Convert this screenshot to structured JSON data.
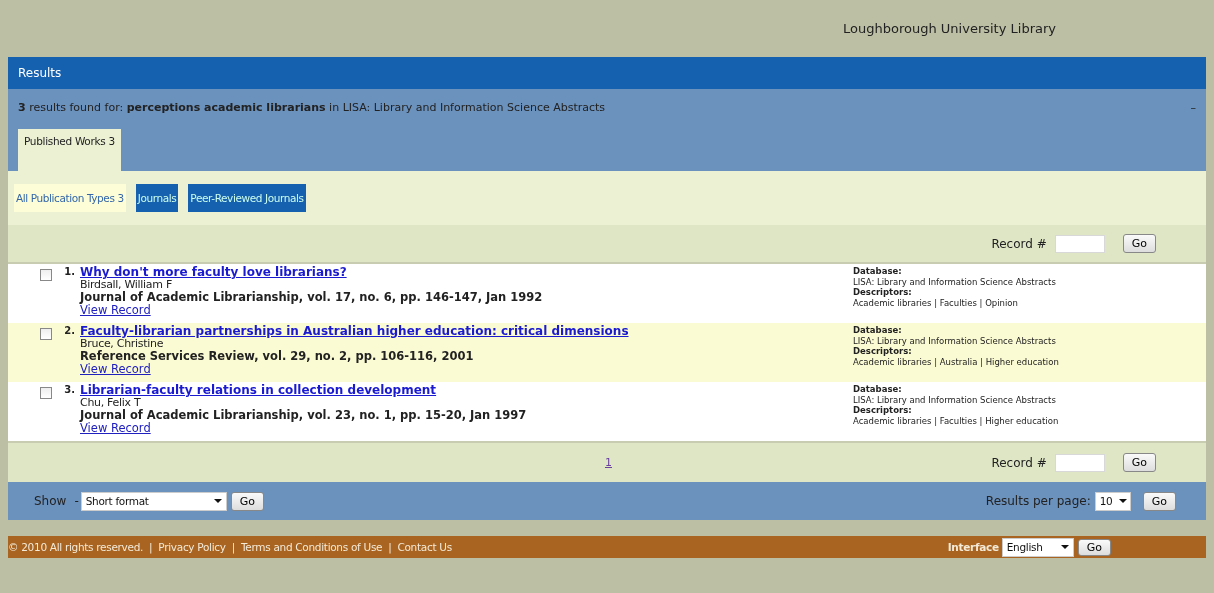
{
  "header": {
    "title": "Loughborough University Library"
  },
  "results_bar": {
    "title": "Results"
  },
  "summary": {
    "text": "**3** results found for: **perceptions academic librarians** in LISA: Library and Information Science Abstracts",
    "collapse": "–"
  },
  "tabs": [
    {
      "label": "Published Works 3",
      "selected": true
    }
  ],
  "filters": [
    {
      "label": "All Publication Types 3",
      "selected": true
    },
    {
      "label": "Journals",
      "selected": false
    },
    {
      "label": "Peer-Reviewed Journals",
      "selected": false
    }
  ],
  "record_jump_top": {
    "label": "Record #",
    "button": "Go"
  },
  "results": [
    {
      "checked": false,
      "shaded": false,
      "number": "1.",
      "title": "Why don't more faculty love librarians?",
      "author": "Birdsall, William F",
      "source": "Journal of Academic Librarianship, vol. 17, no. 6, pp. 146-147, Jan 1992",
      "link": "View Record",
      "database_label": "Database:",
      "database": "LISA: Library and Information Science Abstracts",
      "descriptors_label": "Descriptors:",
      "descriptors": "Academic libraries | Faculties | Opinion"
    },
    {
      "checked": false,
      "shaded": true,
      "number": "2.",
      "title": "Faculty-librarian partnerships in Australian higher education: critical dimensions",
      "author": "Bruce, Christine",
      "source": "Reference Services Review, vol. 29, no. 2, pp. 106-116, 2001",
      "link": "View Record",
      "database_label": "Database:",
      "database": "LISA: Library and Information Science Abstracts",
      "descriptors_label": "Descriptors:",
      "descriptors": "Academic libraries | Australia | Higher education"
    },
    {
      "checked": false,
      "shaded": false,
      "number": "3.",
      "title": "Librarian-faculty relations in collection development",
      "author": "Chu, Felix T",
      "source": "Journal of Academic Librarianship, vol. 23, no. 1, pp. 15-20, Jan 1997",
      "link": "View Record",
      "database_label": "Database:",
      "database": "LISA: Library and Information Science Abstracts",
      "descriptors_label": "Descriptors:",
      "descriptors": "Academic libraries | Faculties | Higher education"
    }
  ],
  "pager": {
    "pages": [
      "1"
    ]
  },
  "record_jump_bottom": {
    "label": "Record #",
    "button": "Go"
  },
  "show_bar": {
    "label": "Show",
    "dash": "-",
    "format": "Short format",
    "button": "Go",
    "per_page_label": "Results per page:",
    "per_page": "10",
    "per_page_button": "Go"
  },
  "footer": {
    "copyright": "© 2010 All rights reserved.",
    "links": [
      {
        "separator": "|",
        "label": "Privacy Policy"
      },
      {
        "separator": "|",
        "label": "Terms and Conditions of Use"
      },
      {
        "separator": "|",
        "label": "Contact Us"
      }
    ],
    "interface_label": "Interface",
    "language": "English",
    "button": "Go"
  }
}
